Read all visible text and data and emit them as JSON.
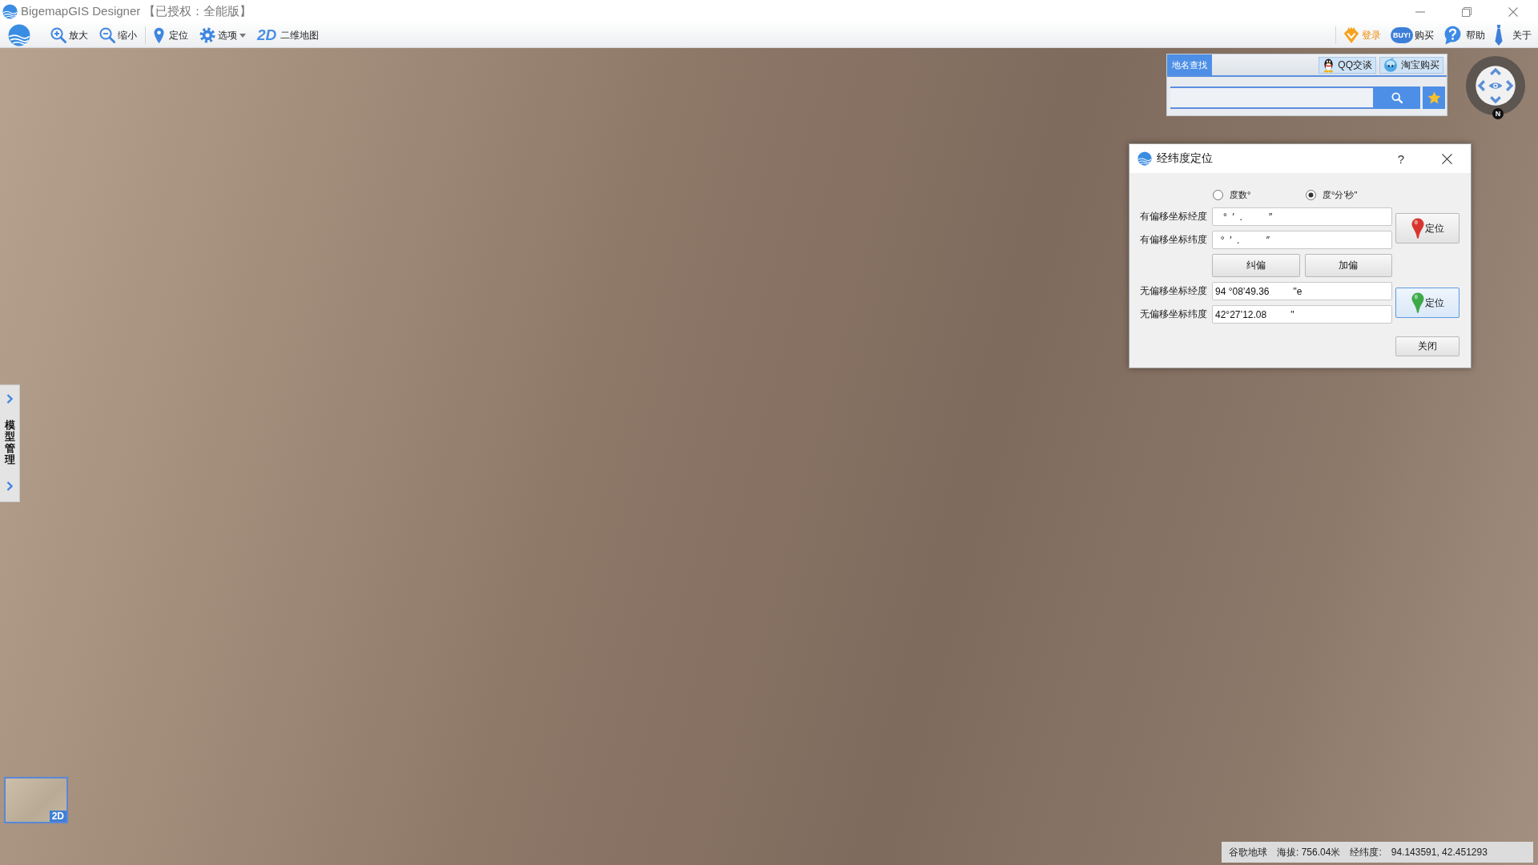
{
  "window": {
    "title": "BigemapGIS Designer 【已授权：全能版】"
  },
  "toolbar": {
    "left": [
      {
        "kind": "zoom_in",
        "label": "放大"
      },
      {
        "kind": "zoom_out",
        "label": "缩小"
      },
      {
        "kind": "locate",
        "label": "定位"
      },
      {
        "kind": "options",
        "label": "选项"
      },
      {
        "kind": "view_2d",
        "badge": "2D",
        "label": "二维地图"
      }
    ],
    "right": [
      {
        "kind": "login",
        "label": "登录"
      },
      {
        "kind": "buy",
        "badge": "BUY!",
        "label": "购买"
      },
      {
        "kind": "help",
        "label": "帮助"
      },
      {
        "kind": "about",
        "label": "关于"
      }
    ]
  },
  "place_search": {
    "tabs": [
      {
        "label": "地名查找",
        "selected": true
      }
    ],
    "links": [
      {
        "kind": "chat",
        "label": "QQ交谈"
      },
      {
        "kind": "shop",
        "label": "淘宝购买"
      }
    ]
  },
  "navigator": {
    "north": "N"
  },
  "dialog": {
    "title": "经纬度定位",
    "help": "?",
    "format_options": [
      {
        "label": "度数°",
        "selected": false
      },
      {
        "label": "度°分'秒\"",
        "selected": true
      }
    ],
    "offset_fields": [
      {
        "label": "有偏移坐标经度",
        "value": "   °  ′  .          ″"
      },
      {
        "label": "有偏移坐标纬度",
        "value": "  °  ′  .          ″"
      }
    ],
    "offset_buttons": [
      "纠偏",
      "加偏"
    ],
    "plain_fields": [
      {
        "label": "无偏移坐标经度",
        "value": "94 °08’49.36         \"e"
      },
      {
        "label": "无偏移坐标纬度",
        "value": "42°27’12.08         \""
      }
    ],
    "locate_buttons": [
      {
        "label": "定位",
        "color": "#d8352f",
        "focused": false
      },
      {
        "label": "定位",
        "color": "#3daa48",
        "focused": true
      }
    ],
    "close_button": "关闭"
  },
  "side_panel": {
    "title": "模型管理"
  },
  "minimap": {
    "badge": "2D"
  },
  "status_bar": {
    "source": "谷歌地球",
    "elevation": "海拔: 756.04米",
    "coords_label": "经纬度:",
    "coords": "94.143591, 42.451293"
  }
}
